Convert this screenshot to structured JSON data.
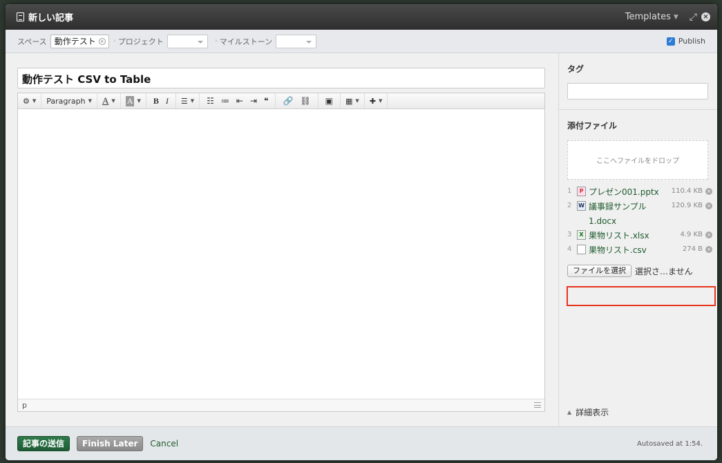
{
  "window": {
    "title": "新しい記事",
    "templates_label": "Templates"
  },
  "meta": {
    "space_label": "スペース",
    "space_value": "動作テスト",
    "project_label": "プロジェクト",
    "milestone_label": "マイルストーン",
    "publish_label": "Publish",
    "publish_checked": true
  },
  "editor": {
    "title_value": "動作テスト CSV to Table",
    "paragraph_label": "Paragraph",
    "status_path": "p"
  },
  "sidebar": {
    "tag_title": "タグ",
    "attachments_title": "添付ファイル",
    "dropzone_text": "ここへファイルをドロップ",
    "files": [
      {
        "num": "1",
        "name": "プレゼン001.pptx",
        "size": "110.4 KB",
        "icon": "pptx-file-icon"
      },
      {
        "num": "2",
        "name": "議事録サンプル1.docx",
        "size": "120.9 KB",
        "icon": "docx-file-icon"
      },
      {
        "num": "3",
        "name": "果物リスト.xlsx",
        "size": "4.9 KB",
        "icon": "xlsx-file-icon"
      },
      {
        "num": "4",
        "name": "果物リスト.csv",
        "size": "274 B",
        "icon": "csv-file-icon"
      }
    ],
    "choose_file_label": "ファイルを選択",
    "no_file_text": "選択さ…ません",
    "details_label": "詳細表示"
  },
  "footer": {
    "send_label": "記事の送信",
    "later_label": "Finish Later",
    "cancel_label": "Cancel",
    "autosave_text": "Autosaved at 1:54."
  },
  "colors": {
    "highlight": "#e8321e",
    "send_button": "#1f5c35",
    "link": "#1e5a2c"
  }
}
